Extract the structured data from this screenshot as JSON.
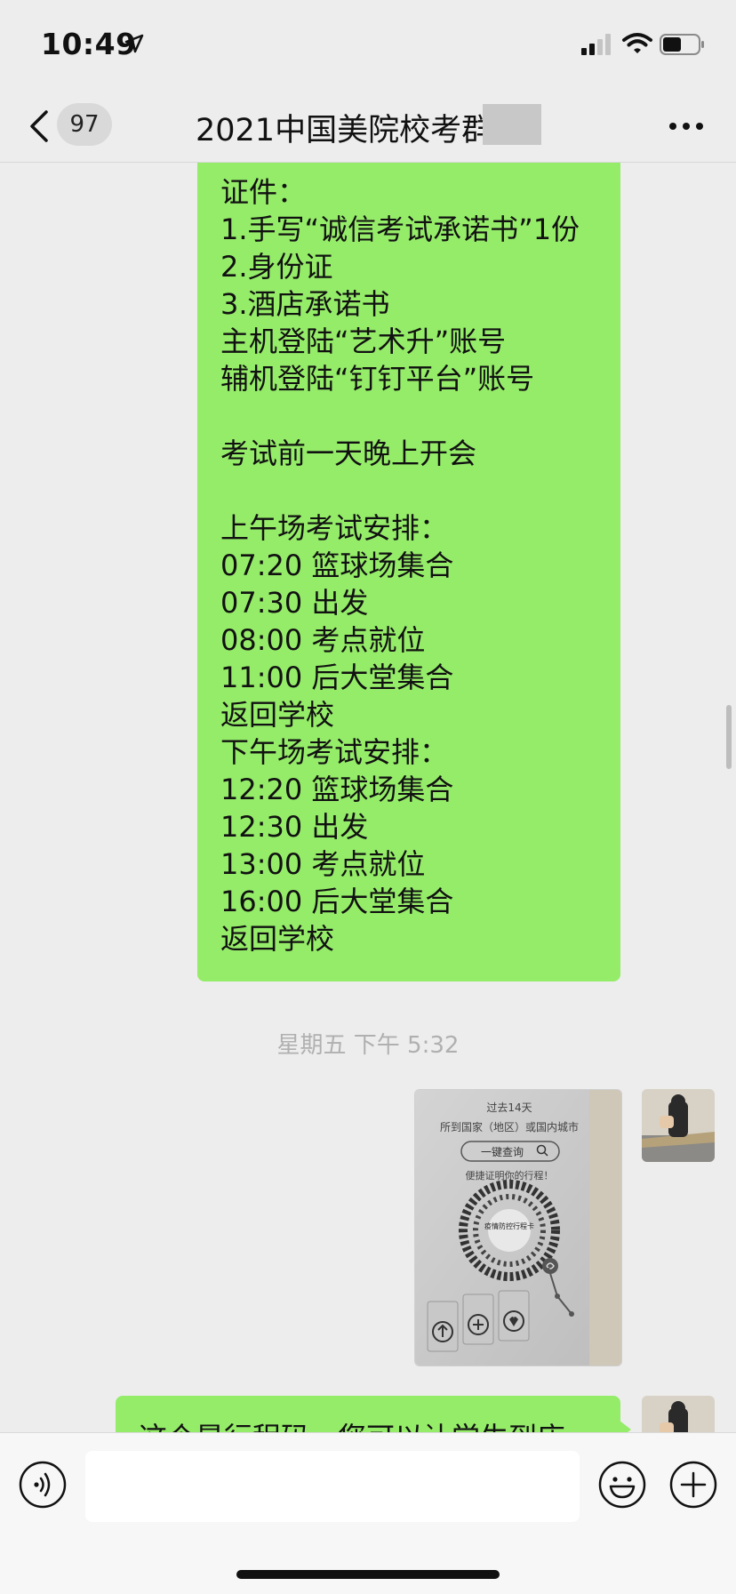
{
  "status_bar": {
    "time": "10:49"
  },
  "nav": {
    "unread_count": "97",
    "title": "2021中国美院校考群"
  },
  "messages": {
    "long_message_lines": [
      "证件：",
      "1.手写“诚信考试承诺书”1份",
      "2.身份证",
      "3.酒店承诺书",
      "主机登陆“艺术升”账号",
      "辅机登陆“钉钉平台”账号",
      "",
      "考试前一天晚上开会",
      "",
      "上午场考试安排：",
      "07:20 篮球场集合",
      "07:30 出发",
      "08:00 考点就位",
      "11:00 后大堂集合",
      "返回学校",
      "下午场考试安排：",
      "12:20 篮球场集合",
      "12:30 出发",
      "13:00 考点就位",
      "16:00 后大堂集合",
      "返回学校"
    ],
    "timestamp": "星期五 下午 5:32",
    "image_message": {
      "line1": "过去14天",
      "line2": "所到国家（地区）或国内城市",
      "button": "一键查询",
      "line3": "便捷证明你的行程！",
      "qr_label": "疫情防控行程卡"
    },
    "short_message": "这个是行程码，您可以让学生到店"
  },
  "input_bar": {
    "placeholder": ""
  },
  "colors": {
    "sent_bubble": "#95ec69",
    "background": "#ededed"
  }
}
